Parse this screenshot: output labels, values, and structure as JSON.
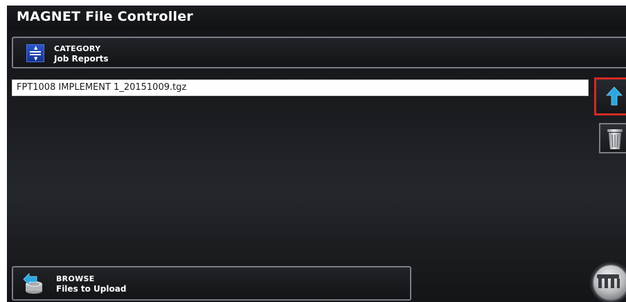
{
  "app": {
    "title": "MAGNET File Controller"
  },
  "category": {
    "label": "CATEGORY",
    "value": "Job Reports",
    "icon": "scroll-list-icon"
  },
  "file_list": {
    "items": [
      {
        "name": "FPT1008 IMPLEMENT 1_20151009.tgz"
      }
    ]
  },
  "side_buttons": {
    "upload_icon": "upload-arrow-icon",
    "delete_icon": "trash-can-icon"
  },
  "browse": {
    "label": "BROWSE",
    "value": "Files to Upload",
    "icon": "files-upload-icon"
  },
  "menu_button": {
    "icon": "machine-menu-icon"
  },
  "colors": {
    "background": "#141518",
    "highlight_border": "#d42a24",
    "accent_blue": "#2aa6e0",
    "category_icon_blue": "#2a56c9",
    "text": "#ffffff"
  }
}
